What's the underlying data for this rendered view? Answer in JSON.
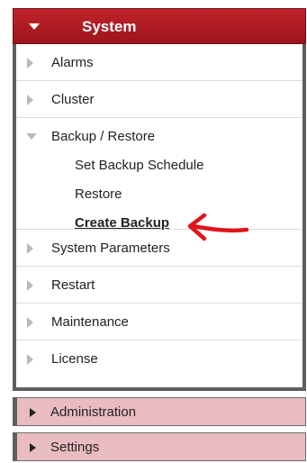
{
  "system_panel": {
    "title": "System",
    "items": [
      {
        "label": "Alarms"
      },
      {
        "label": "Cluster"
      },
      {
        "label": "Backup / Restore",
        "children": [
          {
            "label": "Set Backup Schedule"
          },
          {
            "label": "Restore"
          },
          {
            "label": "Create Backup",
            "active": true
          }
        ]
      },
      {
        "label": "System Parameters"
      },
      {
        "label": "Restart"
      },
      {
        "label": "Maintenance"
      },
      {
        "label": "License"
      }
    ]
  },
  "sections": [
    {
      "label": "Administration"
    },
    {
      "label": "Settings"
    }
  ],
  "colors": {
    "header_red": "#b01c23",
    "section_pink": "#e9bcc2",
    "annotation_arrow": "#e0141b"
  },
  "icons": {
    "header": "caret-down-icon",
    "collapsed_item": "triangle-right-icon",
    "expanded_item": "triangle-down-icon",
    "annotation": "red-arrow-annotation"
  }
}
